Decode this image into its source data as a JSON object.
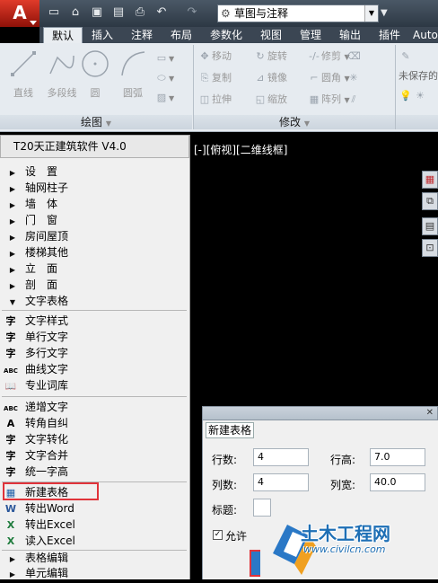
{
  "window": {
    "logo_letter": "A",
    "workspace": "草图与注释"
  },
  "quick_access": [
    {
      "icon": "new-file-icon",
      "glyph": "▭"
    },
    {
      "icon": "open-folder-icon",
      "glyph": "⌂"
    },
    {
      "icon": "save-icon",
      "glyph": "▣"
    },
    {
      "icon": "save-as-icon",
      "glyph": "▤"
    },
    {
      "icon": "print-icon",
      "glyph": "⎙"
    },
    {
      "icon": "undo-icon",
      "glyph": "↶"
    },
    {
      "icon": "redo-icon",
      "glyph": "↷"
    }
  ],
  "tabs": [
    "默认",
    "插入",
    "注释",
    "布局",
    "参数化",
    "视图",
    "管理",
    "输出",
    "插件",
    "Auto"
  ],
  "active_tab": "默认",
  "draw_panel": {
    "title": "绘图",
    "tools": [
      "直线",
      "多段线",
      "圆",
      "圆弧"
    ]
  },
  "modify_panel": {
    "title": "修改",
    "rows": [
      [
        "移动",
        "旋转",
        "修剪"
      ],
      [
        "复制",
        "镜像",
        "圆角"
      ],
      [
        "拉伸",
        "缩放",
        "阵列"
      ]
    ]
  },
  "layer_panel": {
    "state": "未保存的"
  },
  "palette": {
    "title": "T20天正建筑软件 V4.0",
    "menu_items": [
      "设　置",
      "轴网柱子",
      "墙　体",
      "门　窗",
      "房间屋顶",
      "楼梯其他",
      "立　面",
      "剖　面",
      "文字表格"
    ],
    "text_tools": [
      {
        "label": "文字样式",
        "icon": "text-style-icon",
        "glyph": "字"
      },
      {
        "label": "单行文字",
        "icon": "single-line-text-icon",
        "glyph": "字"
      },
      {
        "label": "多行文字",
        "icon": "multiline-text-icon",
        "glyph": "字"
      },
      {
        "label": "曲线文字",
        "icon": "curved-text-icon",
        "glyph": "ABC"
      },
      {
        "label": "专业词库",
        "icon": "dictionary-icon",
        "glyph": "📖"
      }
    ],
    "text_tools2": [
      {
        "label": "递增文字",
        "icon": "increment-text-icon",
        "glyph": "ABC"
      },
      {
        "label": "转角自纠",
        "icon": "corner-correct-icon",
        "glyph": "A"
      },
      {
        "label": "文字转化",
        "icon": "text-convert-icon",
        "glyph": "字"
      },
      {
        "label": "文字合并",
        "icon": "text-merge-icon",
        "glyph": "字"
      },
      {
        "label": "统一字高",
        "icon": "uniform-height-icon",
        "glyph": "字"
      }
    ],
    "table_tools": [
      {
        "label": "新建表格",
        "icon": "new-table-icon",
        "glyph": "▦"
      },
      {
        "label": "转出Word",
        "icon": "export-word-icon",
        "glyph": "W"
      },
      {
        "label": "转出Excel",
        "icon": "export-excel-icon",
        "glyph": "X"
      },
      {
        "label": "读入Excel",
        "icon": "import-excel-icon",
        "glyph": "X"
      }
    ],
    "sub_menus": [
      "表格编辑",
      "单元编辑"
    ]
  },
  "viewport": {
    "label": "[-][俯视][二维线框]"
  },
  "dialog": {
    "title": "新建表格",
    "rows_label": "行数:",
    "rows_value": "4",
    "row_height_label": "行高:",
    "row_height_value": "7.0",
    "cols_label": "列数:",
    "cols_value": "4",
    "col_width_label": "列宽:",
    "col_width_value": "40.0",
    "caption_label": "标题:",
    "allow_label": "允许",
    "close_glyph": "✕"
  },
  "watermark": {
    "name": "土木工程网",
    "url": "www.civilcn.com"
  },
  "colors": {
    "highlight": "#e0333a",
    "brand_red": "#c8281a",
    "watermark_blue": "#1e6fb5"
  }
}
